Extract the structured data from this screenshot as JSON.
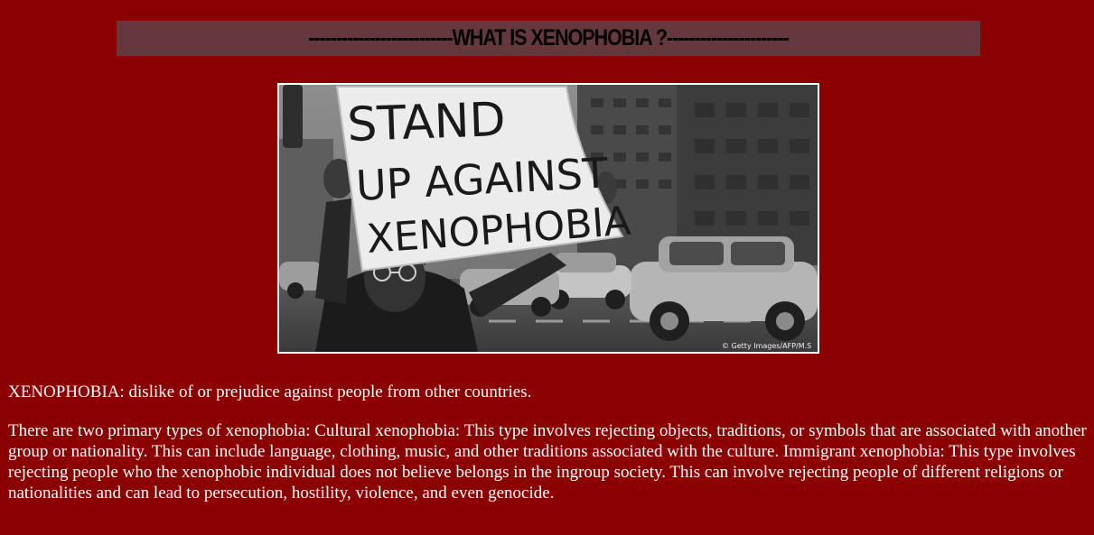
{
  "header": {
    "title": "--------------------------WHAT IS XENOPHOBIA ?----------------------"
  },
  "photo": {
    "sign_lines": [
      "STAND",
      "UP AGAINST",
      "XENOPHOBIA"
    ],
    "credit": "© Getty Images/AFP/M.S"
  },
  "content": {
    "definition": "XENOPHOBIA: dislike of or prejudice against people from other countries.",
    "types": "There are two primary types of xenophobia: Cultural xenophobia: This type involves rejecting objects, traditions, or symbols that are associated with another group or nationality. This can include language, clothing, music, and other traditions associated with the culture. Immigrant xenophobia: This type involves rejecting people who the xenophobic individual does not believe belongs in the ingroup society. This can involve rejecting people of different religions or nationalities and can lead to persecution, hostility, violence, and even genocide."
  },
  "colors": {
    "page_background": "#8b0000",
    "title_bar_background": "#65383d",
    "title_text": "#000000",
    "body_text": "#ffffff"
  }
}
